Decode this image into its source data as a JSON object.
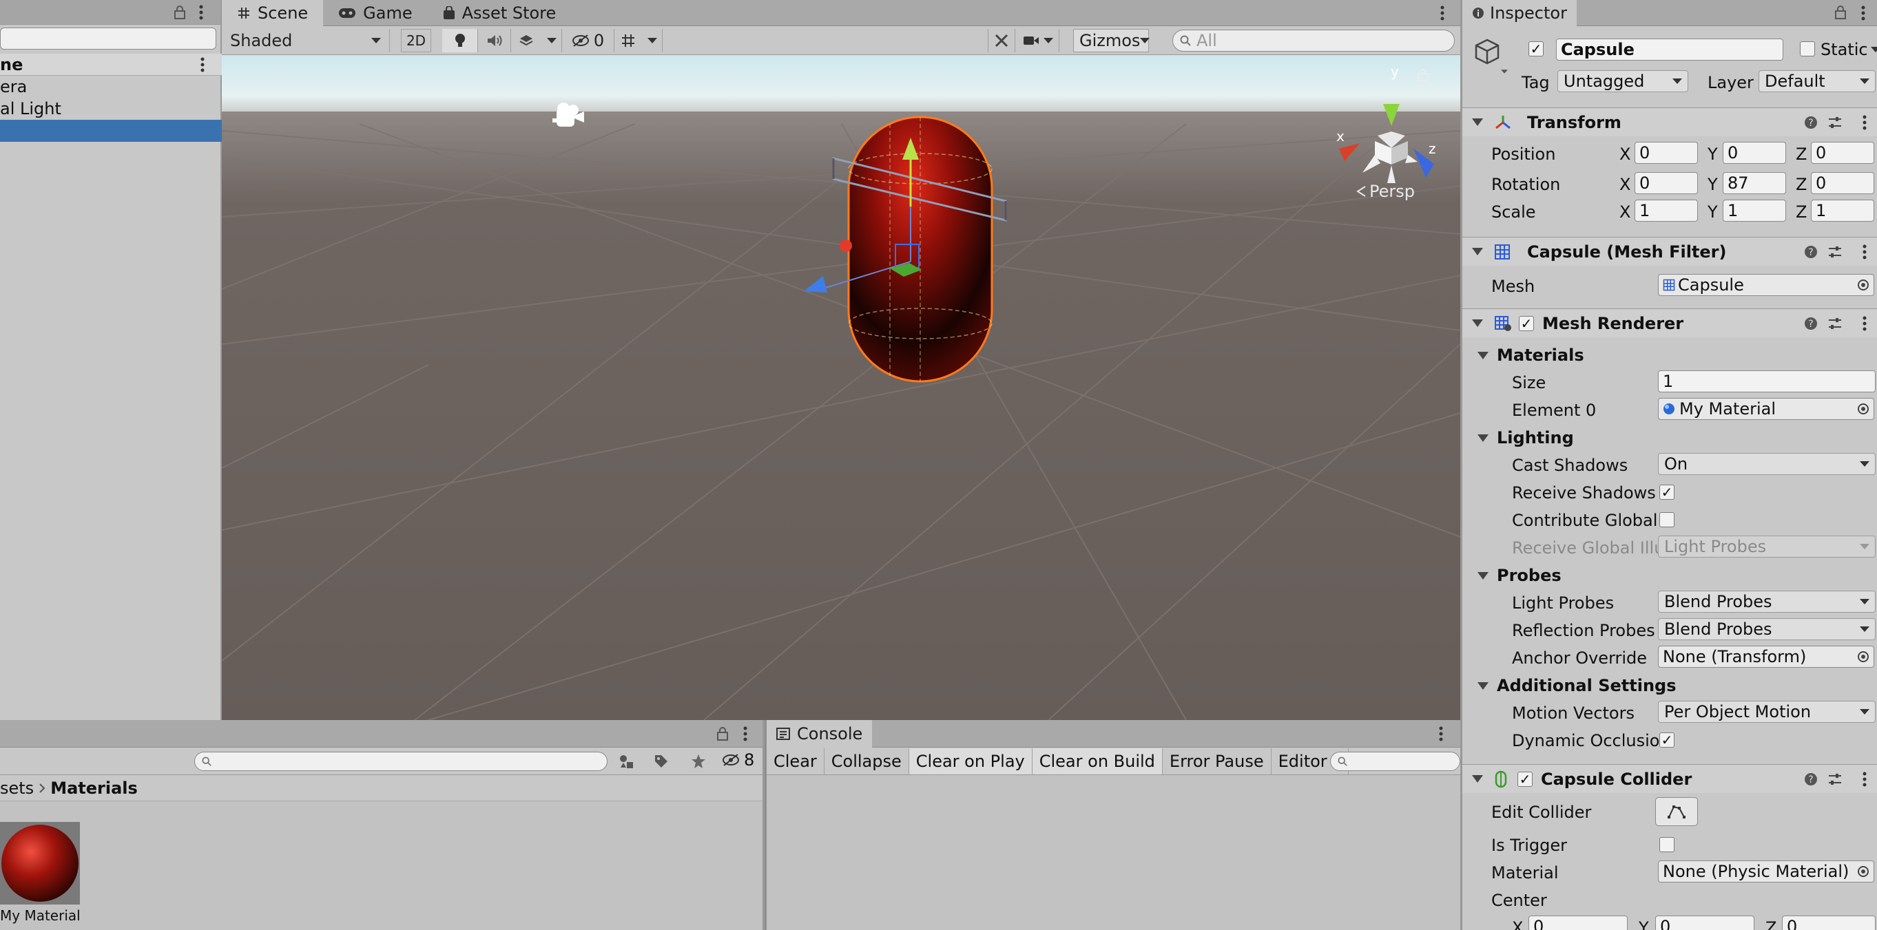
{
  "hierarchy": {
    "column_header": "ne",
    "items": [
      "era",
      "al Light",
      ""
    ]
  },
  "scene_window": {
    "tabs": [
      "Scene",
      "Game",
      "Asset Store"
    ],
    "shading_mode": "Shaded",
    "mode_2d": "2D",
    "hidden_count": "0",
    "gizmos_label": "Gizmos",
    "search_placeholder": "All",
    "persp_label": "Persp",
    "axis_x": "x",
    "axis_y": "y",
    "axis_z": "z"
  },
  "project": {
    "hidden_count": "8",
    "breadcrumb_prefix": "sets",
    "breadcrumb_current": "Materials",
    "asset_name": "My Material"
  },
  "console": {
    "tab": "Console",
    "buttons": [
      "Clear",
      "Collapse",
      "Clear on Play",
      "Clear on Build",
      "Error Pause",
      "Editor"
    ]
  },
  "inspector": {
    "tab": "Inspector",
    "object_name": "Capsule",
    "static_label": "Static",
    "tag_label": "Tag",
    "tag_value": "Untagged",
    "layer_label": "Layer",
    "layer_value": "Default",
    "transform": {
      "title": "Transform",
      "position_label": "Position",
      "rotation_label": "Rotation",
      "scale_label": "Scale",
      "position": [
        "0",
        "0",
        "0"
      ],
      "rotation": [
        "0",
        "87",
        "0"
      ],
      "scale": [
        "1",
        "1",
        "1"
      ],
      "x": "X",
      "y": "Y",
      "z": "Z"
    },
    "mesh_filter": {
      "title": "Capsule (Mesh Filter)",
      "mesh_label": "Mesh",
      "mesh_value": "Capsule"
    },
    "mesh_renderer": {
      "title": "Mesh Renderer",
      "materials_header": "Materials",
      "size_label": "Size",
      "size_value": "1",
      "element0_label": "Element 0",
      "element0_value": "My Material",
      "lighting_header": "Lighting",
      "cast_shadows_label": "Cast Shadows",
      "cast_shadows_value": "On",
      "receive_shadows_label": "Receive Shadows",
      "contribute_gi_label": "Contribute Global I",
      "receive_gi_label": "Receive Global Illu",
      "receive_gi_value": "Light Probes",
      "probes_header": "Probes",
      "light_probes_label": "Light Probes",
      "light_probes_value": "Blend Probes",
      "reflection_probes_label": "Reflection Probes",
      "reflection_probes_value": "Blend Probes",
      "anchor_override_label": "Anchor Override",
      "anchor_override_value": "None (Transform)",
      "additional_header": "Additional Settings",
      "motion_vectors_label": "Motion Vectors",
      "motion_vectors_value": "Per Object Motion",
      "dynamic_occlusion_label": "Dynamic Occlusio"
    },
    "capsule_collider": {
      "title": "Capsule Collider",
      "edit_collider_label": "Edit Collider",
      "is_trigger_label": "Is Trigger",
      "material_label": "Material",
      "material_value": "None (Physic Material)",
      "center_label": "Center",
      "center": [
        "0",
        "0",
        "0"
      ]
    }
  },
  "colors": {
    "selection": "#3a72b0",
    "panel": "#c8c8c8",
    "ground": "#6b625e",
    "capsule_outline": "#ff7a1a"
  }
}
